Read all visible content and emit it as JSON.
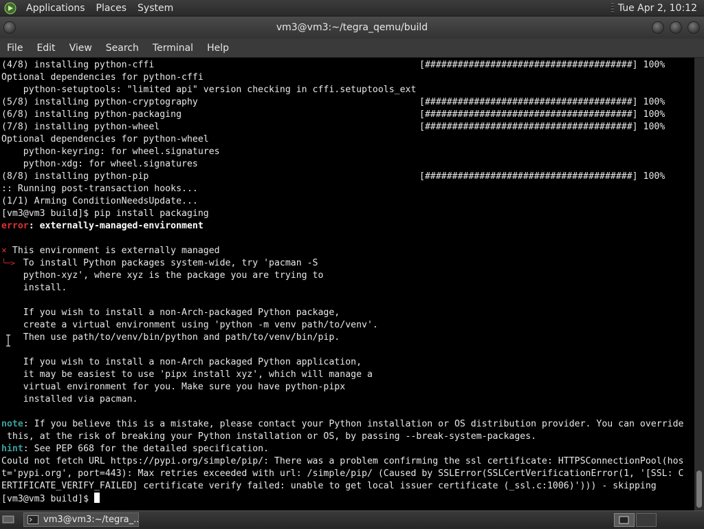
{
  "top_panel": {
    "menus": [
      "Applications",
      "Places",
      "System"
    ],
    "clock": "Tue Apr  2, 10:12"
  },
  "window": {
    "title": "vm3@vm3:~/tegra_qemu/build",
    "menus": [
      "File",
      "Edit",
      "View",
      "Search",
      "Terminal",
      "Help"
    ]
  },
  "terminal": {
    "lines": [
      "(4/8) installing python-cffi",
      "Optional dependencies for python-cffi",
      "    python-setuptools: \"limited api\" version checking in cffi.setuptools_ext",
      "(5/8) installing python-cryptography",
      "(6/8) installing python-packaging",
      "(7/8) installing python-wheel",
      "Optional dependencies for python-wheel",
      "    python-keyring: for wheel.signatures",
      "    python-xdg: for wheel.signatures",
      "(8/8) installing python-pip",
      ":: Running post-transaction hooks...",
      "(1/1) Arming ConditionNeedsUpdate...",
      "[vm3@vm3 build]$ pip install packaging",
      "",
      "",
      " This environment is externally managed",
      "    To install Python packages system-wide, try 'pacman -S",
      "    python-xyz', where xyz is the package you are trying to",
      "    install.",
      "",
      "    If you wish to install a non-Arch-packaged Python package,",
      "    create a virtual environment using 'python -m venv path/to/venv'.",
      "    Then use path/to/venv/bin/python and path/to/venv/bin/pip.",
      "",
      "    If you wish to install a non-Arch packaged Python application,",
      "    it may be easiest to use 'pipx install xyz', which will manage a",
      "    virtual environment for you. Make sure you have python-pipx",
      "    installed via pacman.",
      "",
      "",
      " this, at the risk of breaking your Python installation or OS, by passing --break-system-packages.",
      "",
      "Could not fetch URL https://pypi.org/simple/pip/: There was a problem confirming the ssl certificate: HTTPSConnectionPool(hos",
      "t='pypi.org', port=443): Max retries exceeded with url: /simple/pip/ (Caused by SSLError(SSLCertVerificationError(1, '[SSL: C",
      "ERTIFICATE_VERIFY_FAILED] certificate verify failed: unable to get local issuer certificate (_ssl.c:1006)'))) - skipping",
      "[vm3@vm3 build]$ "
    ],
    "progress_bar": "[######################################] 100%",
    "error_prefix": "error",
    "error_message": ": externally-managed-environment",
    "cross_mark": "×",
    "arrow_mark": "╰─>",
    "note_prefix": "note",
    "note_message": ": If you believe this is a mistake, please contact your Python installation or OS distribution provider. You can override",
    "hint_prefix": "hint",
    "hint_message": ": See PEP 668 for the detailed specification."
  },
  "taskbar": {
    "task_label": "vm3@vm3:~/tegra_..."
  },
  "colors": {
    "error_red": "#e03030",
    "note_cyan": "#3aa0a0",
    "terminal_bg": "#000000"
  }
}
